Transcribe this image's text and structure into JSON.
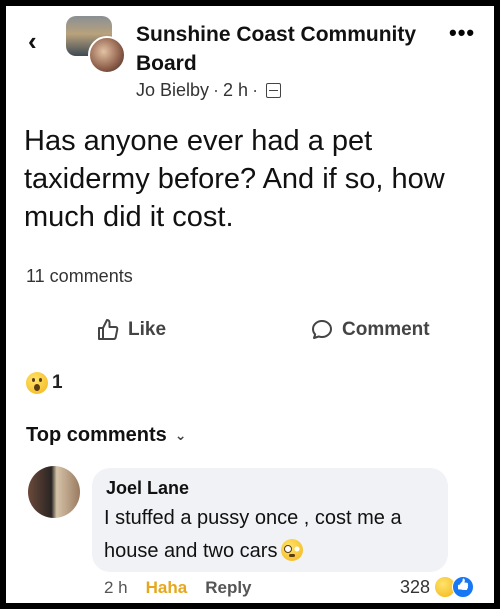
{
  "header": {
    "back_icon": "chevron-left-icon",
    "group_name": "Sunshine Coast Community Board",
    "author": "Jo Bielby",
    "time": "2 h",
    "visibility_icon": "group-members-icon",
    "more_icon": "more-horizontal-icon",
    "more_label": "•••"
  },
  "post": {
    "text": "Has anyone ever had a pet taxidermy before? And if so, how much did it cost.",
    "comment_count": "11 comments"
  },
  "actions": {
    "like_label": "Like",
    "comment_label": "Comment"
  },
  "reactions": {
    "icon": "wow-emoji-icon",
    "count": "1"
  },
  "top_comments": {
    "label": "Top comments",
    "chevron_icon": "chevron-down-icon"
  },
  "comment": {
    "author": "Joel Lane",
    "text": "I stuffed a pussy once , cost me a house and two cars",
    "emoji": "flushed-emoji-icon",
    "time": "2 h",
    "reaction_label": "Haha",
    "reply_label": "Reply",
    "reaction_count": "328"
  },
  "colors": {
    "haha": "#e6a71c",
    "like_blue": "#1877f2",
    "bubble_bg": "#f0f2f5"
  }
}
